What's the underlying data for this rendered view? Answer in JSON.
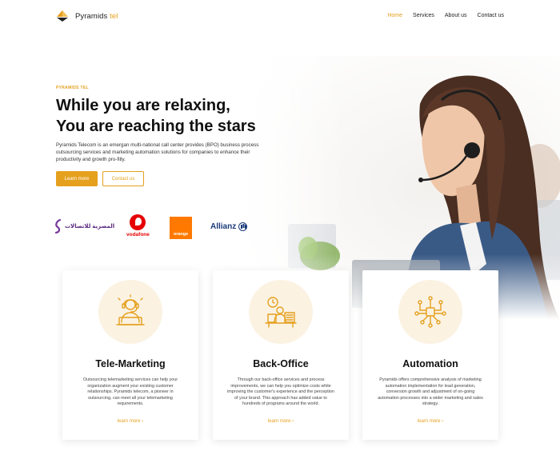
{
  "header": {
    "logo_name": "Pyramids",
    "logo_accent": "tel",
    "nav": [
      {
        "label": "Home",
        "active": true
      },
      {
        "label": "Services",
        "active": false
      },
      {
        "label": "About us",
        "active": false
      },
      {
        "label": "Contact us",
        "active": false
      }
    ]
  },
  "hero": {
    "eyebrow": "PYRAMIDS TEL",
    "headline_line1": "While you are relaxing,",
    "headline_line2": "You are reaching the stars",
    "description": "Pyramids Telecom is an emergan multi-national call center provides (BPO) business process outsourcing services and marketing automation solutions for companies to enhance their productivity and growth pro-fitly.",
    "primary_button": "Learn more",
    "secondary_button": "Contact us"
  },
  "partners": {
    "eg": "المصرية للاتصالات",
    "vodafone": "vodafone",
    "orange": "orange",
    "allianz": "Allianz"
  },
  "services": [
    {
      "title": "Tele-Marketing",
      "icon": "headset-agent-icon",
      "description": "Outsourcing telemarketing services can help your organization augment your existing customer relationships. Pyramids telecom, a pioneer in outsourcing, can meet all your telemarketing requirements.",
      "link": "learn more ›"
    },
    {
      "title": "Back-Office",
      "icon": "office-worker-icon",
      "description": "Through our back-office services and process improvements, we can help you optimize costs while improving the customer's experience and the perception of your brand. This approach has added value to hundreds of programs around the world.",
      "link": "learn more ›"
    },
    {
      "title": "Automation",
      "icon": "network-nodes-icon",
      "description": "Pyramids offers comprehensive analysis of marketing automation implementation for lead generation, conversion growth and adjustment of on-going automation processes into a wider marketing and sales strategy.",
      "link": "learn more ›"
    }
  ],
  "colors": {
    "accent": "#e5a01e",
    "icon_bg": "#fbf2e2"
  }
}
